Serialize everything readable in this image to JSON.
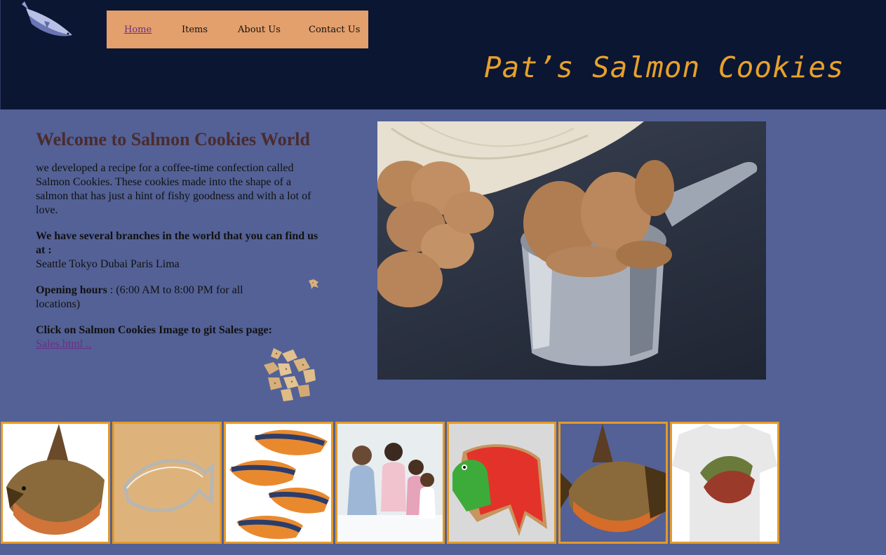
{
  "nav": {
    "items": [
      {
        "label": "Home",
        "active": true
      },
      {
        "label": "Items",
        "active": false
      },
      {
        "label": "About Us",
        "active": false
      },
      {
        "label": "Contact Us",
        "active": false
      }
    ]
  },
  "header": {
    "title": "Pat’s Salmon Cookies",
    "logo_icon": "salmon-icon"
  },
  "main": {
    "heading": "Welcome to Salmon Cookies World",
    "intro": "we developed a recipe for a coffee-time confection called Salmon Cookies. These cookies made into the shape of a salmon that has just a hint of fishy goodness and with a lot of love.",
    "branches_label": "We have several branches in the world that you can find us at :",
    "branches": "Seattle Tokyo Dubai Paris Lima",
    "hours_label": "Opening hours",
    "hours_text": " : (6:00 AM to 8:00 PM for all locations)",
    "sales_prompt": "Click on Salmon Cookies Image to git Sales page:",
    "sales_link": "Sales.html .."
  },
  "gallery": [
    {
      "name": "chinook-salmon-illustration"
    },
    {
      "name": "salmon-cookie-cutter"
    },
    {
      "name": "salmon-magnets"
    },
    {
      "name": "family-photo"
    },
    {
      "name": "frosted-salmon-cookie"
    },
    {
      "name": "salmon-illustration-blue"
    },
    {
      "name": "salmon-tshirt"
    }
  ],
  "colors": {
    "page_bg": "#536196",
    "header_bg": "#0b1633",
    "nav_bg": "#e39f6c",
    "title": "#e7a12a",
    "heading": "#4a2b2e",
    "link": "#6a2f86",
    "thumb_border": "#e39a2a"
  }
}
